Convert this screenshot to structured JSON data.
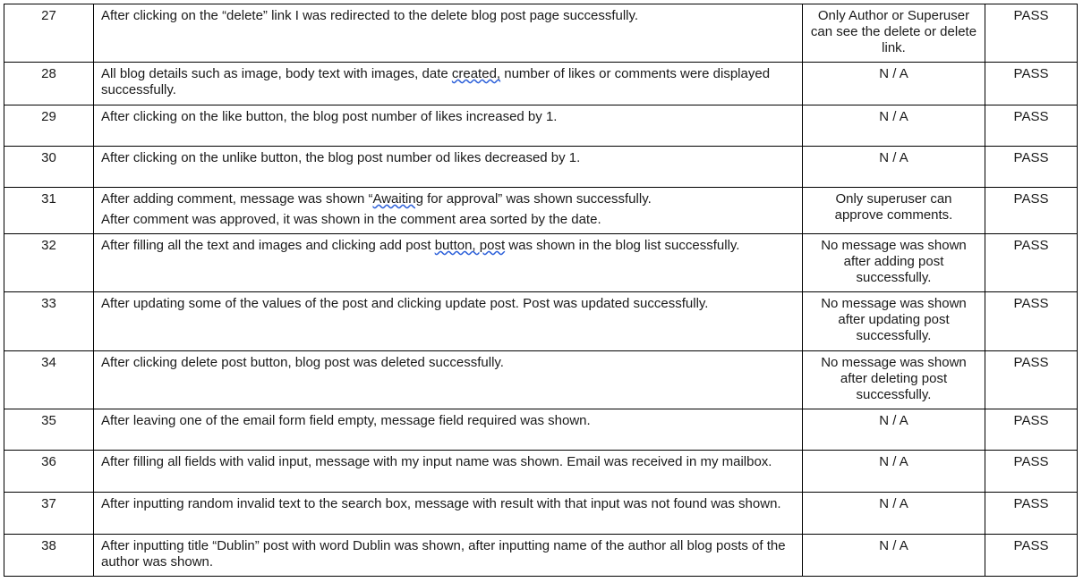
{
  "rows": [
    {
      "num": "27",
      "desc": [
        {
          "parts": [
            {
              "t": "After clicking on the “delete” link I was redirected to the delete blog post page successfully."
            }
          ]
        }
      ],
      "note": "Only Author or Superuser can see the delete or delete link.",
      "result": "PASS"
    },
    {
      "num": "28",
      "desc": [
        {
          "parts": [
            {
              "t": "All blog details such as image, body text with images, date "
            },
            {
              "t": "created,",
              "sq": true
            },
            {
              "t": " number of likes or comments were displayed successfully."
            }
          ]
        }
      ],
      "note": "N / A",
      "result": "PASS"
    },
    {
      "num": "29",
      "desc": [
        {
          "parts": [
            {
              "t": "After clicking on the like button, the blog post number of likes increased by 1."
            }
          ]
        }
      ],
      "note": "N / A",
      "result": "PASS"
    },
    {
      "num": "30",
      "desc": [
        {
          "parts": [
            {
              "t": "After clicking on the unlike button, the blog post number od likes decreased by 1."
            }
          ]
        }
      ],
      "note": "N / A",
      "result": "PASS"
    },
    {
      "num": "31",
      "desc": [
        {
          "parts": [
            {
              "t": "After adding comment, message was shown “"
            },
            {
              "t": "Awaiting",
              "sq": true
            },
            {
              "t": " for approval” was shown successfully."
            }
          ]
        },
        {
          "parts": [
            {
              "t": "After comment was approved, it was shown in the comment area sorted by the date."
            }
          ]
        }
      ],
      "note": "Only superuser can approve comments.",
      "result": "PASS"
    },
    {
      "num": "32",
      "desc": [
        {
          "parts": [
            {
              "t": "After filling all the text and images and clicking add post "
            },
            {
              "t": "button,  post",
              "sq": true
            },
            {
              "t": " was shown in the blog list successfully."
            }
          ]
        }
      ],
      "note": "No message was shown after adding post successfully.",
      "result": "PASS"
    },
    {
      "num": "33",
      "desc": [
        {
          "parts": [
            {
              "t": "After updating some of the values of the post and clicking update post. Post was updated successfully."
            }
          ]
        }
      ],
      "note": "No message was shown after updating post successfully.",
      "result": "PASS"
    },
    {
      "num": "34",
      "desc": [
        {
          "parts": [
            {
              "t": "After clicking delete post button, blog post was deleted successfully."
            }
          ]
        }
      ],
      "note": "No message was shown after deleting post successfully.",
      "result": "PASS"
    },
    {
      "num": "35",
      "desc": [
        {
          "parts": [
            {
              "t": "After leaving one of the email form field empty, message field required was shown."
            }
          ]
        }
      ],
      "note": "N / A",
      "result": "PASS"
    },
    {
      "num": "36",
      "desc": [
        {
          "parts": [
            {
              "t": "After filling all fields with valid input, message with my input name was shown. Email was received in my mailbox."
            }
          ]
        }
      ],
      "note": "N / A",
      "result": "PASS"
    },
    {
      "num": "37",
      "desc": [
        {
          "parts": [
            {
              "t": "After inputting random invalid text to the search box, message with result with that input was not found was shown."
            }
          ]
        }
      ],
      "note": "N / A",
      "result": "PASS"
    },
    {
      "num": "38",
      "desc": [
        {
          "parts": [
            {
              "t": "After inputting title “Dublin” post with word Dublin was shown, after inputting name of the author all blog posts of the author was shown."
            }
          ]
        }
      ],
      "note": "N / A",
      "result": "PASS"
    }
  ]
}
